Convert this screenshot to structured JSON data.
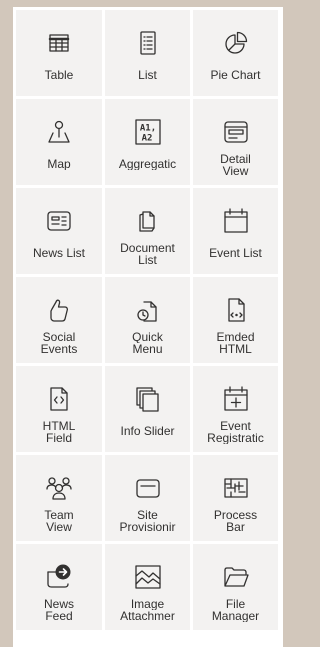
{
  "tiles": [
    {
      "lines": [
        "Table"
      ],
      "icon": "table-icon"
    },
    {
      "lines": [
        "List"
      ],
      "icon": "list-icon"
    },
    {
      "lines": [
        "Pie Chart"
      ],
      "icon": "pie-chart-icon"
    },
    {
      "lines": [
        "Map"
      ],
      "icon": "map-pin-icon"
    },
    {
      "lines": [
        "Aggregatic"
      ],
      "icon": "aggregation-icon"
    },
    {
      "lines": [
        "Detail",
        "View"
      ],
      "icon": "detail-view-icon"
    },
    {
      "lines": [
        "News List"
      ],
      "icon": "news-list-icon"
    },
    {
      "lines": [
        "Document",
        "List"
      ],
      "icon": "document-icon"
    },
    {
      "lines": [
        "Event List"
      ],
      "icon": "calendar-icon"
    },
    {
      "lines": [
        "Social",
        "Events"
      ],
      "icon": "thumbs-up-icon"
    },
    {
      "lines": [
        "Quick",
        "Menu"
      ],
      "icon": "quick-menu-icon"
    },
    {
      "lines": [
        "Emded",
        "HTML"
      ],
      "icon": "embed-html-icon"
    },
    {
      "lines": [
        "HTML",
        "Field"
      ],
      "icon": "html-field-icon"
    },
    {
      "lines": [
        "Info Slider"
      ],
      "icon": "info-slider-icon"
    },
    {
      "lines": [
        "Event",
        "Registratic"
      ],
      "icon": "event-registration-icon"
    },
    {
      "lines": [
        "Team",
        "View"
      ],
      "icon": "team-icon"
    },
    {
      "lines": [
        "Site",
        "Provisionir"
      ],
      "icon": "site-provisioning-icon"
    },
    {
      "lines": [
        "Process",
        "Bar"
      ],
      "icon": "process-bar-icon"
    },
    {
      "lines": [
        "News",
        "Feed"
      ],
      "icon": "news-feed-icon"
    },
    {
      "lines": [
        "Image",
        "Attachmer"
      ],
      "icon": "image-icon"
    },
    {
      "lines": [
        "File",
        "Manager"
      ],
      "icon": "folder-icon"
    }
  ],
  "colors": {
    "background": "#d2c7bb",
    "tile": "#f3f2f1",
    "text": "#323130",
    "icon": "#323130"
  }
}
